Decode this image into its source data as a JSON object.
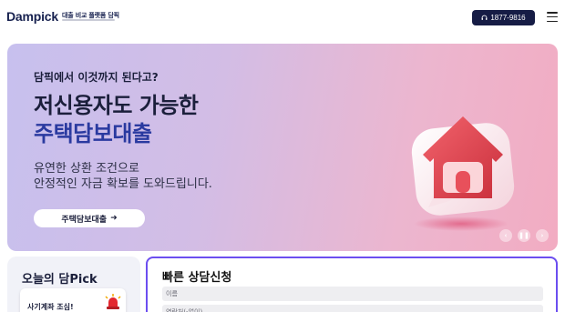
{
  "header": {
    "logo": "Dampick",
    "logo_tagline": "대출 비교 플랫폼 담픽",
    "phone": "1877-9816"
  },
  "hero": {
    "pre_title": "담픽에서 이것까지 된다고?",
    "title_line1": "저신용자도 가능한",
    "title_line2": "주택담보대출",
    "desc_line1": "유연한 상환 조건으로",
    "desc_line2": "안정적인 자금 확보를 도와드립니다.",
    "cta_label": "주택담보대출",
    "cta_arrow": "➜"
  },
  "slider_controls": {
    "prev": "‹",
    "pause": "❚❚",
    "next": "›"
  },
  "today_pick": {
    "title": "오늘의 담Pick",
    "card_text": "사기계좌 조심!"
  },
  "consult": {
    "title": "빠른 상담신청",
    "name_placeholder": "이름",
    "phone_placeholder": "연락처(-없이)"
  },
  "colors": {
    "brand_navy": "#161c45",
    "hero_accent": "#2a3aa0",
    "consult_border": "#6c4ef0",
    "house_red": "#e8505b"
  },
  "icons": {
    "phone": "headset-icon",
    "menu": "hamburger-menu-icon",
    "house": "house-icon",
    "siren": "siren-icon"
  }
}
